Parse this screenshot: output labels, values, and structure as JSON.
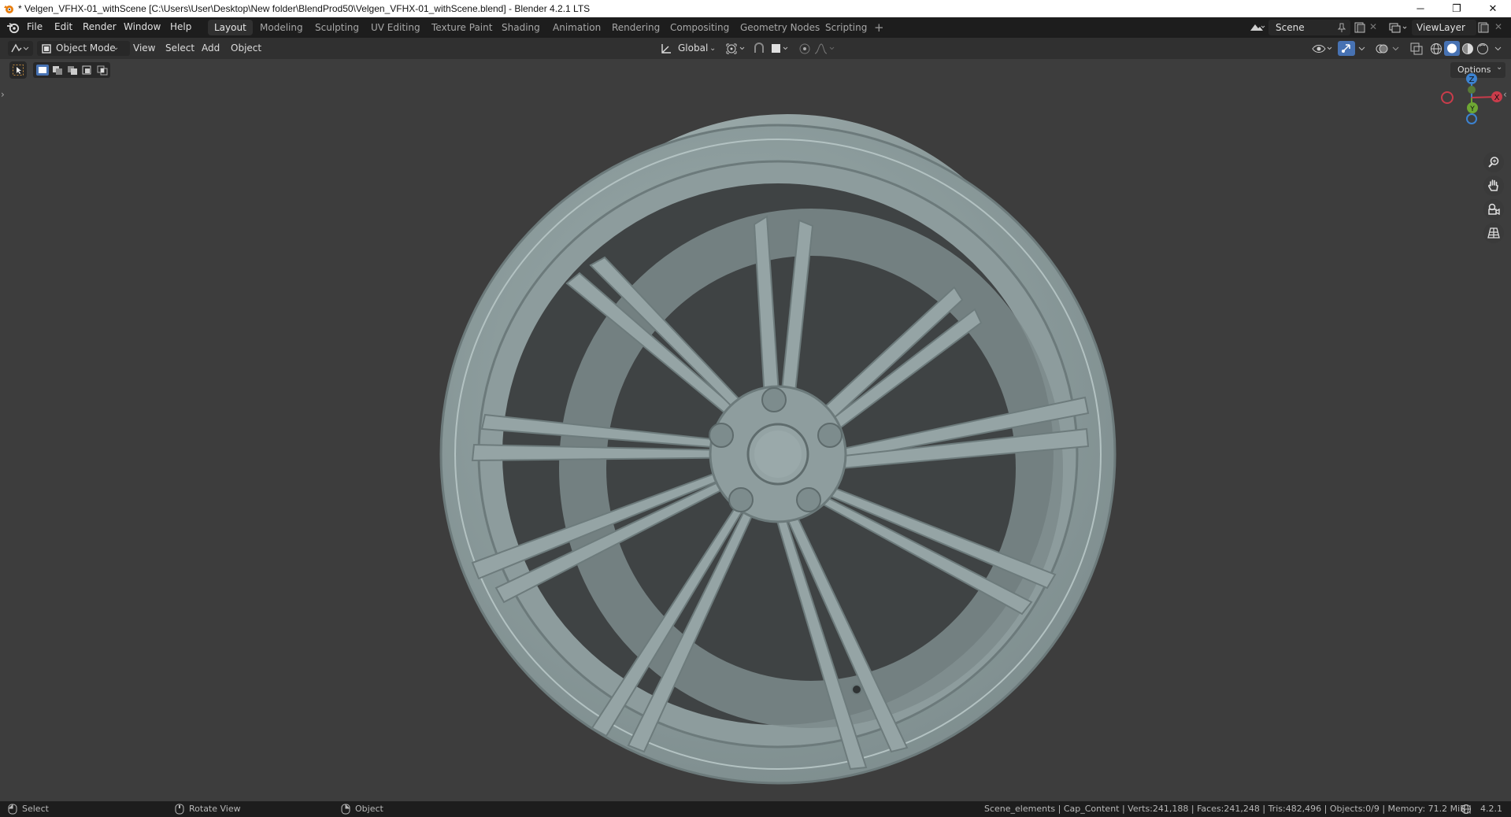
{
  "window": {
    "title": "* Velgen_VFHX-01_withScene [C:\\Users\\User\\Desktop\\New folder\\BlendProd50\\Velgen_VFHX-01_withScene.blend] - Blender 4.2.1 LTS",
    "minimize": "─",
    "maximize": "❐",
    "close": "✕"
  },
  "menu": [
    "File",
    "Edit",
    "Render",
    "Window",
    "Help"
  ],
  "workspaces": [
    "Layout",
    "Modeling",
    "Sculpting",
    "UV Editing",
    "Texture Paint",
    "Shading",
    "Animation",
    "Rendering",
    "Compositing",
    "Geometry Nodes",
    "Scripting"
  ],
  "active_workspace": "Layout",
  "add_workspace": "+",
  "scene": {
    "label": "Scene"
  },
  "viewlayer": {
    "label": "ViewLayer"
  },
  "header": {
    "mode": "Object Mode",
    "view": "View",
    "select": "Select",
    "add": "Add",
    "object": "Object",
    "orientation": "Global",
    "options": "Options"
  },
  "gizmo": {
    "z": "Z",
    "y": "Y",
    "x": "X"
  },
  "status": {
    "select": "Select",
    "rotate": "Rotate View",
    "object": "Object",
    "stats": "Scene_elements | Cap_Content | Verts:241,188 | Faces:241,248 | Tris:482,496 | Objects:0/9 | Memory: 71.2 MiB |",
    "version": "4.2.1"
  },
  "colors": {
    "accent": "#4772b3",
    "axis_x": "#c93c4b",
    "axis_y": "#6ea733",
    "axis_z": "#3c82d0",
    "wheel": "#8c9b9b",
    "viewport_bg": "#3d3d3d"
  }
}
